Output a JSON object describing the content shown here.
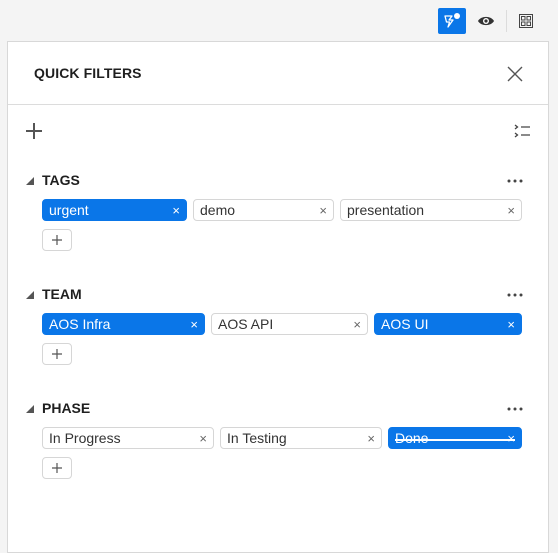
{
  "toolbar": {
    "quick_filter_icon": "quick-filter-icon",
    "view_icon": "eye-icon",
    "layout_icon": "grid-layout-icon",
    "accent_color": "#0a76e8"
  },
  "panel": {
    "title": "QUICK FILTERS",
    "close_icon": "close-icon",
    "add_icon": "plus-icon",
    "expand_icon": "expand-list-icon"
  },
  "sections": [
    {
      "title": "TAGS",
      "chips": [
        {
          "label": "urgent",
          "selected": true,
          "excluded": false
        },
        {
          "label": "demo",
          "selected": false,
          "excluded": false
        },
        {
          "label": "presentation",
          "selected": false,
          "excluded": false
        }
      ]
    },
    {
      "title": "TEAM",
      "chips": [
        {
          "label": "AOS Infra",
          "selected": true,
          "excluded": false
        },
        {
          "label": "AOS API",
          "selected": false,
          "excluded": false
        },
        {
          "label": "AOS UI",
          "selected": true,
          "excluded": false
        }
      ]
    },
    {
      "title": "PHASE",
      "chips": [
        {
          "label": "In Progress",
          "selected": false,
          "excluded": false
        },
        {
          "label": "In Testing",
          "selected": false,
          "excluded": false
        },
        {
          "label": "Done",
          "selected": true,
          "excluded": true
        }
      ]
    }
  ],
  "chip_remove_glyph": "×",
  "add_chip_glyph": "+"
}
